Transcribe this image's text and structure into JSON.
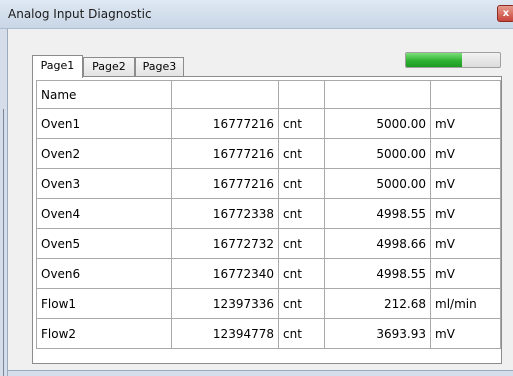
{
  "window": {
    "title": "Analog Input Diagnostic",
    "close_label": "x"
  },
  "tabs": [
    "Page1",
    "Page2",
    "Page3"
  ],
  "progress": {
    "fraction": 0.6
  },
  "table": {
    "headers": [
      "Name",
      "",
      "",
      "",
      ""
    ],
    "rows": [
      {
        "name": "Oven1",
        "count": "16777216",
        "count_unit": "cnt",
        "value": "5000.00",
        "unit": "mV"
      },
      {
        "name": "Oven2",
        "count": "16777216",
        "count_unit": "cnt",
        "value": "5000.00",
        "unit": "mV"
      },
      {
        "name": "Oven3",
        "count": "16777216",
        "count_unit": "cnt",
        "value": "5000.00",
        "unit": "mV"
      },
      {
        "name": "Oven4",
        "count": "16772338",
        "count_unit": "cnt",
        "value": "4998.55",
        "unit": "mV"
      },
      {
        "name": "Oven5",
        "count": "16772732",
        "count_unit": "cnt",
        "value": "4998.66",
        "unit": "mV"
      },
      {
        "name": "Oven6",
        "count": "16772340",
        "count_unit": "cnt",
        "value": "4998.55",
        "unit": "mV"
      },
      {
        "name": "Flow1",
        "count": "12397336",
        "count_unit": "cnt",
        "value": "212.68",
        "unit": "ml/min"
      },
      {
        "name": "Flow2",
        "count": "12394778",
        "count_unit": "cnt",
        "value": "3693.93",
        "unit": "mV"
      }
    ]
  }
}
